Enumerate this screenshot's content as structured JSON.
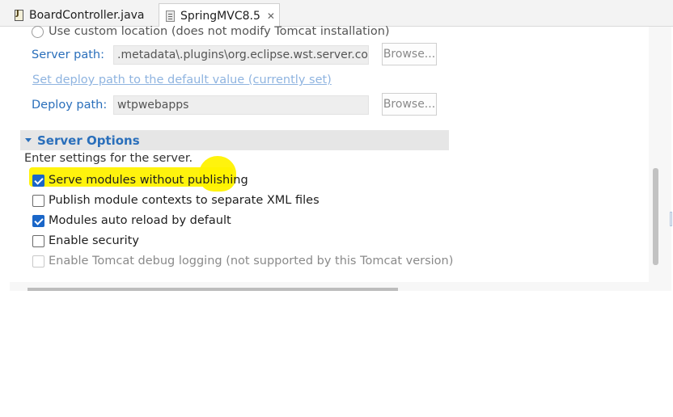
{
  "tabs": [
    {
      "label": "BoardController.java",
      "icon": "java-file-icon",
      "active": false
    },
    {
      "label": "SpringMVC8.5",
      "icon": "server-icon",
      "active": true,
      "close_glyph": "✕"
    }
  ],
  "server_locations": {
    "custom_location_label": "Use custom location (does not modify Tomcat installation)",
    "server_path_label": "Server path:",
    "server_path_value": ".metadata\\.plugins\\org.eclipse.wst.server.core",
    "browse_label": "Browse...",
    "set_deploy_link": "Set deploy path to the default value (currently set)",
    "deploy_path_label": "Deploy path:",
    "deploy_path_value": "wtpwebapps"
  },
  "server_options": {
    "title": "Server Options",
    "description": "Enter settings for the server.",
    "options": [
      {
        "label": "Serve modules without publishing",
        "checked": true,
        "enabled": true,
        "highlighted": true
      },
      {
        "label": "Publish module contexts to separate XML files",
        "checked": false,
        "enabled": true
      },
      {
        "label": "Modules auto reload by default",
        "checked": true,
        "enabled": true
      },
      {
        "label": "Enable security",
        "checked": false,
        "enabled": true
      },
      {
        "label": "Enable Tomcat debug logging (not supported by this Tomcat version)",
        "checked": false,
        "enabled": false
      }
    ]
  },
  "colors": {
    "accent_blue": "#2a6fbb",
    "checkbox_blue": "#1a66c8",
    "highlight_yellow": "#fff200"
  }
}
